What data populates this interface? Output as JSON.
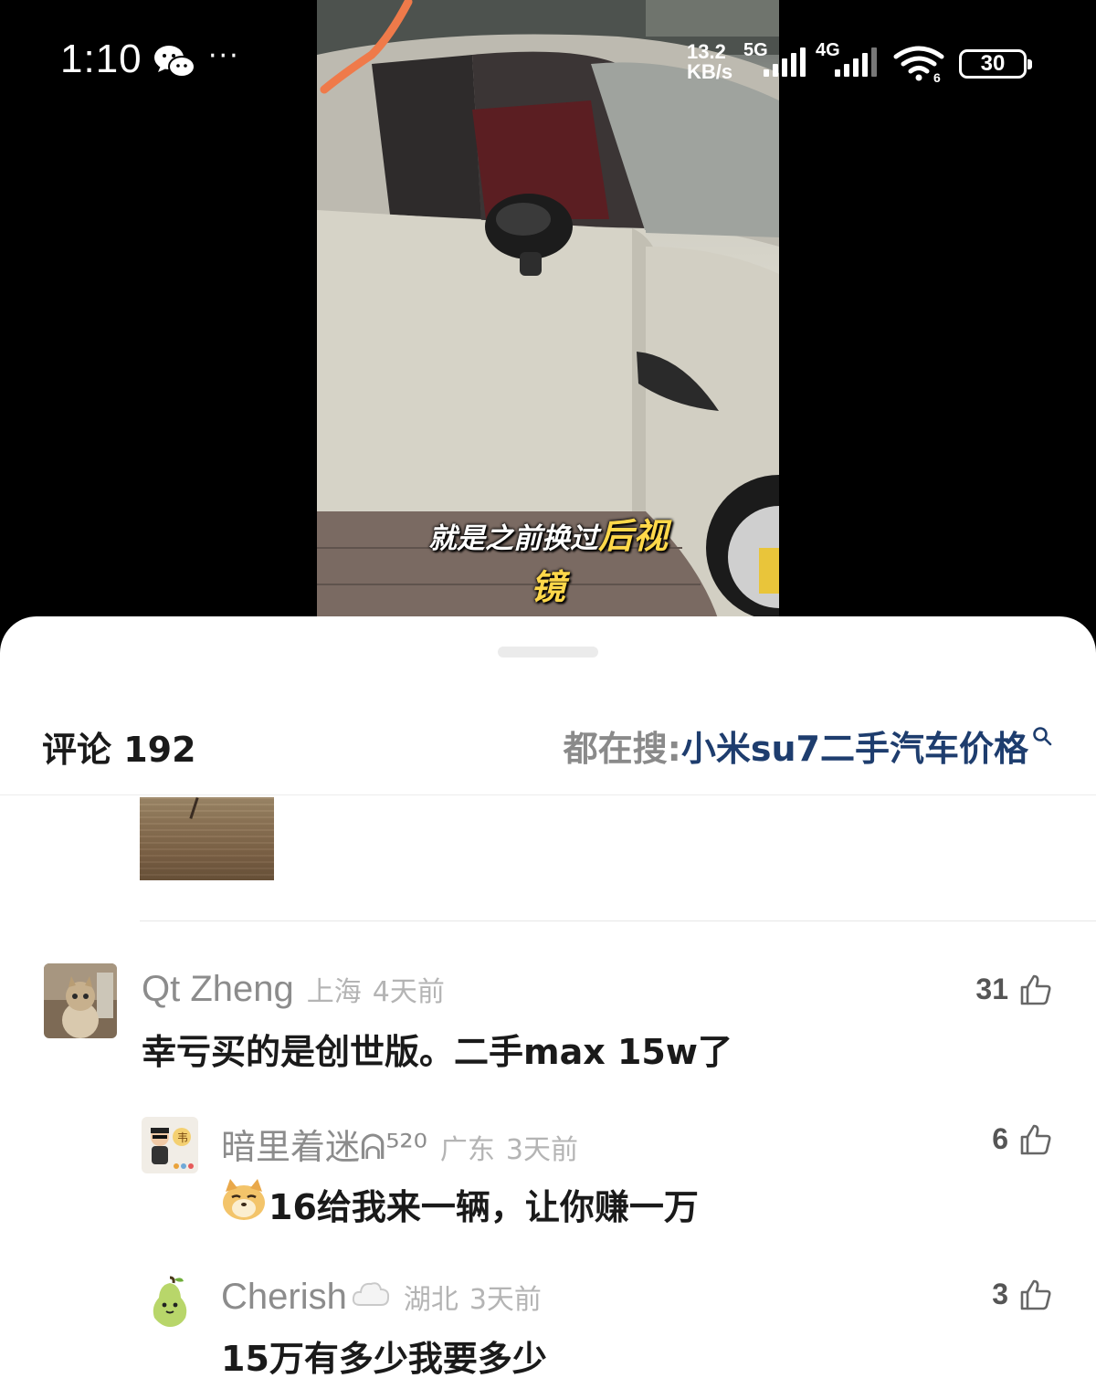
{
  "status_bar": {
    "time": "1:10",
    "more": "···",
    "speed_value": "13.2",
    "speed_unit": "KB/s",
    "network_5g": "5G",
    "network_4g": "4G",
    "wifi_badge": "6",
    "battery": "30"
  },
  "video": {
    "caption_part1": "就是之前换过",
    "caption_highlight": "后视",
    "caption_line2": "镜"
  },
  "comments_panel": {
    "count_label": "评论 192",
    "search_prefix": "都在搜: ",
    "search_term": "小米su7二手汽车价格"
  },
  "comments": [
    {
      "name": "Qt Zheng",
      "location": "上海",
      "time": "4天前",
      "text": "幸亏买的是创世版。二手max 15w了",
      "likes": "31"
    },
    {
      "name": "暗里着迷ᕱ⁵²⁰",
      "location": "广东",
      "time": "3天前",
      "text": "16给我来一辆，让你赚一万",
      "likes": "6"
    },
    {
      "name": "Cherish",
      "location": "湖北",
      "time": "3天前",
      "text": "15万有多少我要多少",
      "likes": "3"
    }
  ],
  "colors": {
    "search_term": "#1e3d6e",
    "caption_highlight": "#ffd84a",
    "meta_gray": "#8c8c8c"
  }
}
